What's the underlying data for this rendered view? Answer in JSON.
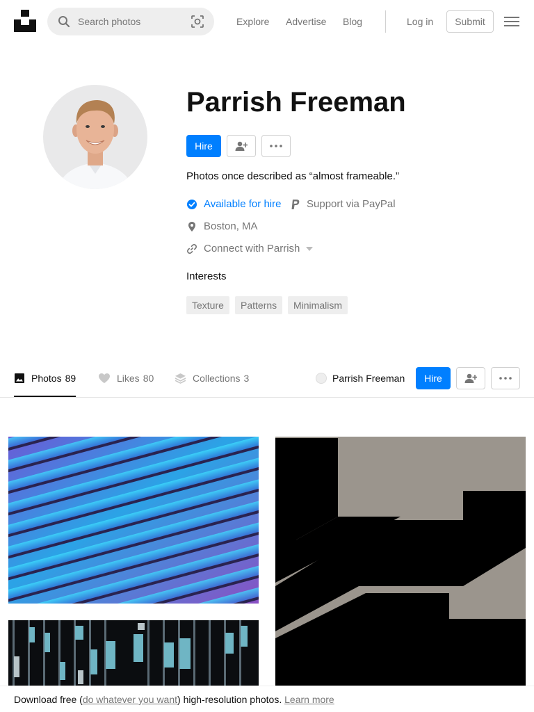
{
  "header": {
    "search_placeholder": "Search photos",
    "nav": [
      "Explore",
      "Advertise",
      "Blog"
    ],
    "login": "Log in",
    "submit": "Submit"
  },
  "profile": {
    "name": "Parrish Freeman",
    "hire_label": "Hire",
    "bio": "Photos once described as “almost frameable.”",
    "available": "Available for hire",
    "support": "Support via PayPal",
    "location": "Boston, MA",
    "connect": "Connect with Parrish",
    "interests_title": "Interests",
    "interests": [
      "Texture",
      "Patterns",
      "Minimalism"
    ]
  },
  "tabs": {
    "photos": {
      "label": "Photos",
      "count": "89"
    },
    "likes": {
      "label": "Likes",
      "count": "80"
    },
    "collections": {
      "label": "Collections",
      "count": "3"
    },
    "user_name": "Parrish Freeman",
    "hire_label": "Hire"
  },
  "banner": {
    "prefix": "Download free (",
    "link": "do whatever you want",
    "suffix": ") high-resolution photos.",
    "learn_more": "Learn more"
  },
  "colors": {
    "accent": "#007fff",
    "muted": "#767676",
    "verified": "#007fff"
  },
  "icons": {
    "logo": "unsplash-logo-icon",
    "search": "search-icon",
    "visual_search": "visual-search-icon",
    "menu": "hamburger-menu-icon",
    "follow": "add-user-icon",
    "more": "more-dots-icon",
    "verified": "check-circle-icon",
    "paypal": "paypal-icon",
    "location": "map-pin-icon",
    "link": "link-icon",
    "photos": "image-icon",
    "likes": "heart-icon",
    "collections": "layers-icon"
  }
}
